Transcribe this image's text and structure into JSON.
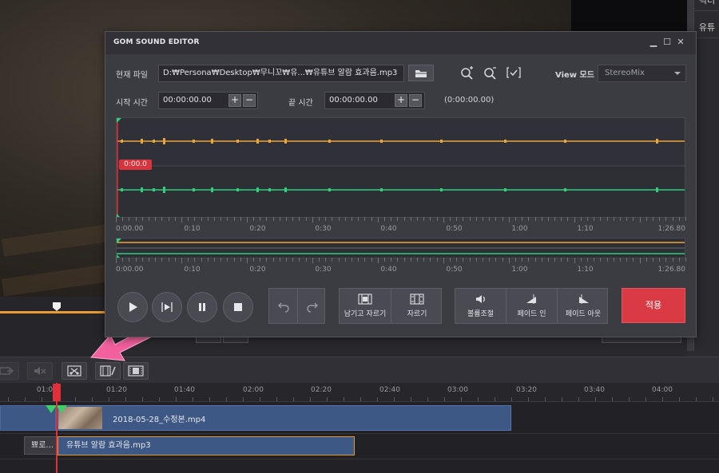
{
  "dialog": {
    "title": "GOM SOUND EDITOR",
    "minimize": "▁",
    "maximize": "☐",
    "close": "✕",
    "file_label": "현재 파일",
    "file_path": "D:₩Persona₩Desktop₩무니꼬₩유...₩유튜브 알람 효과음.mp3",
    "view_mode_label": "View 모드",
    "view_mode_value": "StereoMix",
    "start_label": "시작 시간",
    "start_value": "00:00:00.00",
    "end_label": "끝 시간",
    "end_value": "00:00:00.00",
    "duration": "(0:00:00.00)",
    "plus": "+",
    "minus": "−",
    "cursor_time": "0:00.0",
    "axis_labels": [
      "0:00.00",
      "0:10",
      "0:20",
      "0:30",
      "0:40",
      "0:50",
      "1:00",
      "1:10",
      "1:26.80"
    ],
    "buttons": {
      "keep_cut": "남기고 자르기",
      "cut": "자르기",
      "volume": "볼륨조절",
      "fade_in": "페이드 인",
      "fade_out": "페이드 아웃",
      "apply": "적용"
    }
  },
  "right_panel": [
    "픽터",
    "유튜"
  ],
  "timeline": {
    "ruler": [
      "01:0",
      "01:20",
      "01:40",
      "02:00",
      "02:20",
      "02:40",
      "03:00",
      "03:20",
      "03:40",
      "04:00"
    ],
    "video_clip_label": "2018-05-28_수정본.mp4",
    "audio_small_label": "뾰로...",
    "audio_clip_label": "유튜브 알람 효과음.mp3"
  },
  "colors": {
    "accent_orange": "#e8a53a",
    "accent_green": "#2fd07c",
    "playhead_red": "#e0303a",
    "apply_red": "#d93a44",
    "arrow_pink": "#f2609e"
  }
}
